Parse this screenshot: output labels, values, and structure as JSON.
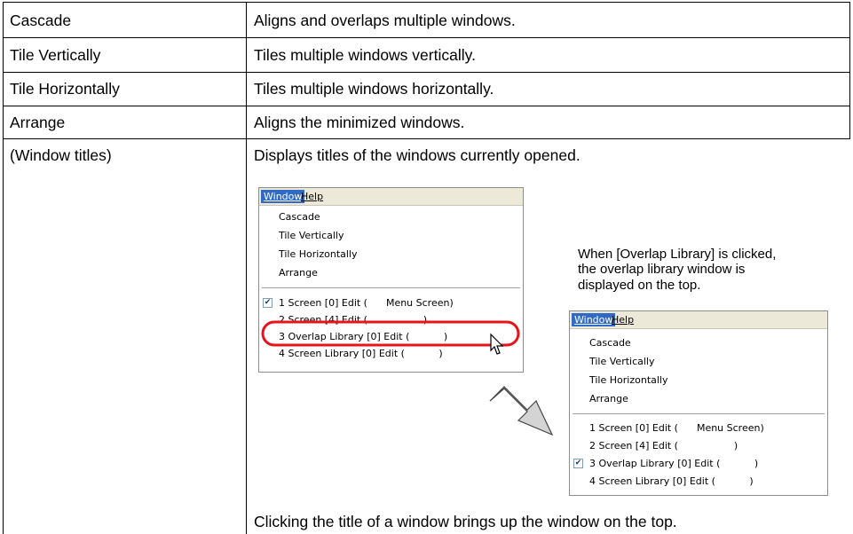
{
  "rows": [
    {
      "term": "Cascade",
      "description": "Aligns and overlaps multiple windows."
    },
    {
      "term": "Tile Vertically",
      "description": "Tiles multiple windows vertically."
    },
    {
      "term": "Tile Horizontally",
      "description": "Tiles multiple windows horizontally."
    },
    {
      "term": "Arrange",
      "description": "Aligns the minimized windows."
    },
    {
      "term": "(Window titles)",
      "description": "Displays titles of the windows currently opened."
    }
  ],
  "footer_text": "Clicking the title of a window brings up the window on the top.",
  "note_lines": [
    "When [Overlap Library] is clicked,",
    "the overlap library window is",
    "displayed on the top."
  ],
  "menu_before": {
    "menubar": [
      "Window",
      "Help"
    ],
    "items": [
      "Cascade",
      "Tile Vertically",
      "Tile Horizontally",
      "Arrange"
    ],
    "windows": [
      {
        "label": "1 Screen [0] Edit (      Menu Screen)",
        "checked": true
      },
      {
        "label": "2 Screen [4] Edit (                  )",
        "checked": false
      },
      {
        "label": "3 Overlap Library [0] Edit (           )",
        "checked": false
      },
      {
        "label": "4 Screen Library [0] Edit (           )",
        "checked": false
      }
    ]
  },
  "menu_after": {
    "menubar": [
      "Window",
      "Help"
    ],
    "items": [
      "Cascade",
      "Tile Vertically",
      "Tile Horizontally",
      "Arrange"
    ],
    "windows": [
      {
        "label": "1 Screen [0] Edit (      Menu Screen)",
        "checked": false
      },
      {
        "label": "2 Screen [4] Edit (                  )",
        "checked": false
      },
      {
        "label": "3 Overlap Library [0] Edit (           )",
        "checked": true
      },
      {
        "label": "4 Screen Library [0] Edit (           )",
        "checked": false
      }
    ]
  },
  "colors": {
    "menu_highlight": "#316ac5",
    "callout_ring": "#e8141c",
    "arrow_fill": "#d4d4d4"
  }
}
